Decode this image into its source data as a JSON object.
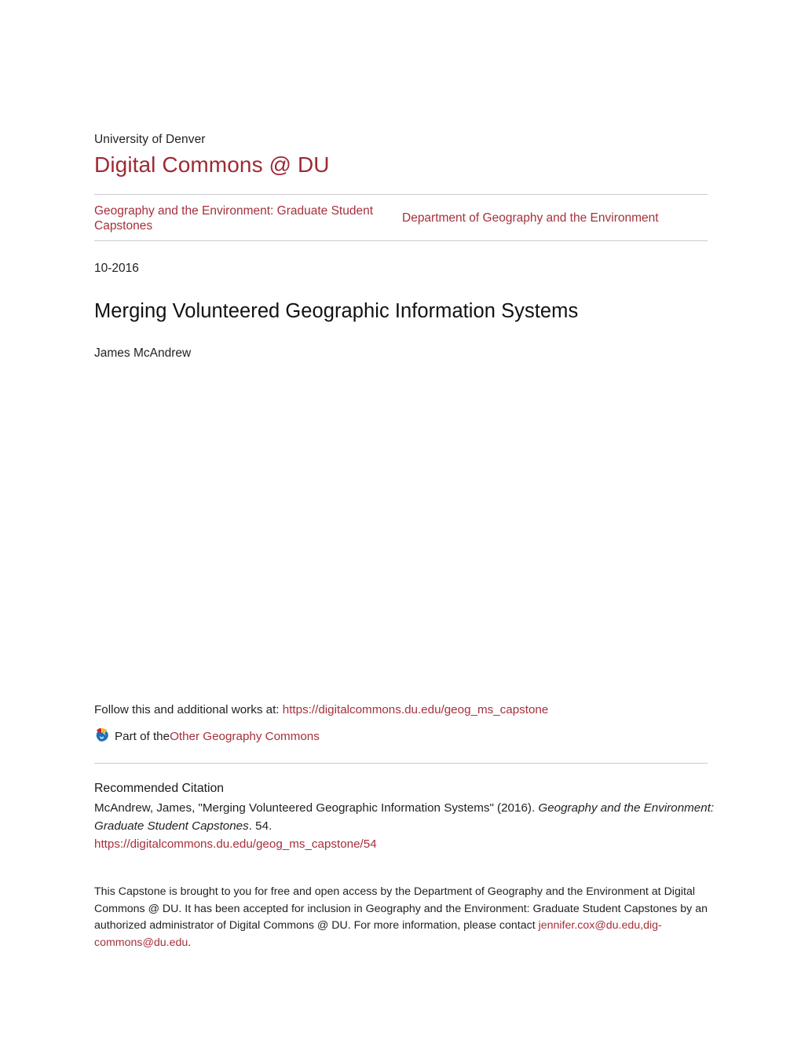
{
  "masthead": {
    "university": "University of Denver",
    "repository": "Digital Commons @ DU"
  },
  "series_band": {
    "series_label": "Geography and the Environment: Graduate Student Capstones",
    "department_label": "Department of Geography and the Environment"
  },
  "record": {
    "date": "10-2016",
    "title": "Merging Volunteered Geographic Information Systems",
    "author": "James McAndrew"
  },
  "follow": {
    "prefix": "Follow this and additional works at: ",
    "url_text": "https://digitalcommons.du.edu/geog_ms_capstone",
    "part_of_prefix": "Part of the ",
    "commons_link": "Other Geography Commons",
    "badge_icon": "digital-commons-network-icon"
  },
  "citation": {
    "heading": "Recommended Citation",
    "text_1": "McAndrew, James, \"Merging Volunteered Geographic Information Systems\" (2016). ",
    "italic_1": "Geography and the Environment: Graduate Student Capstones",
    "text_2": ". 54.",
    "url": "https://digitalcommons.du.edu/geog_ms_capstone/54"
  },
  "disclaimer": {
    "text": "This Capstone is brought to you for free and open access by the Department of Geography and the Environment at Digital Commons @ DU. It has been accepted for inclusion in Geography and the Environment: Graduate Student Capstones by an authorized administrator of Digital Commons @ DU. For more information, please contact ",
    "email_link": "jennifer.cox@du.edu,dig-commons@du.edu",
    "suffix": "."
  },
  "colors": {
    "brand_crimson": "#9e2a35",
    "link_crimson": "#a6303b",
    "rule_gray": "#c9c9c9",
    "body_text": "#222222",
    "badge_blue": "#1f6fb8",
    "badge_red": "#d2232a",
    "badge_yellow": "#f2b61b"
  }
}
